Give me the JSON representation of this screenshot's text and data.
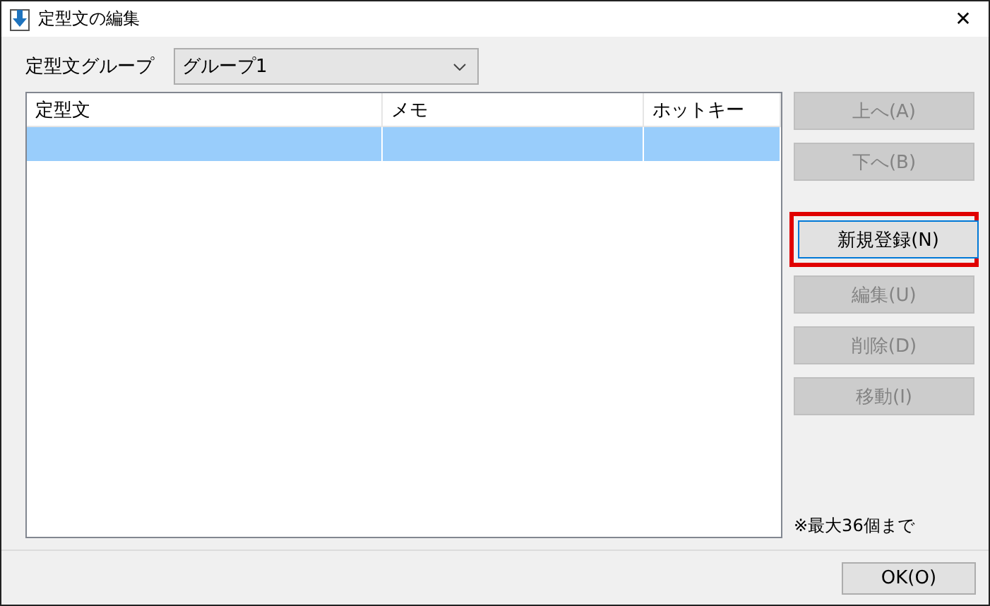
{
  "window": {
    "title": "定型文の編集",
    "close": "✕"
  },
  "group": {
    "label": "定型文グループ",
    "value": "グループ1"
  },
  "table": {
    "columns": [
      "定型文",
      "メモ",
      "ホットキー"
    ],
    "rows": [
      {
        "selected": true
      }
    ]
  },
  "button_groups": [
    [
      {
        "label": "上へ(A)",
        "disabled": true,
        "highlighted": false
      },
      {
        "label": "下へ(B)",
        "disabled": true,
        "highlighted": false
      }
    ],
    [
      {
        "label": "新規登録(N)",
        "disabled": false,
        "highlighted": true
      },
      {
        "label": "編集(U)",
        "disabled": true,
        "highlighted": false
      },
      {
        "label": "削除(D)",
        "disabled": true,
        "highlighted": false
      },
      {
        "label": "移動(I)",
        "disabled": true,
        "highlighted": false
      }
    ]
  ],
  "note": "※最大36個まで",
  "ok_button": "OK(O)"
}
